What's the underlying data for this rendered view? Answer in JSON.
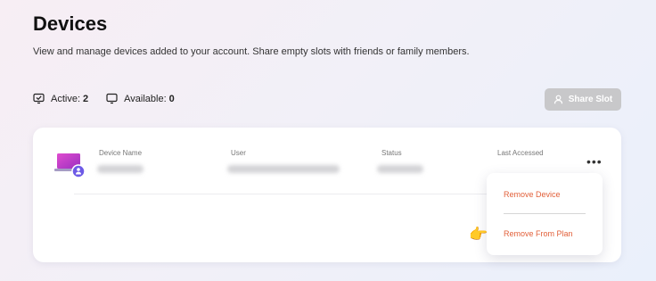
{
  "page": {
    "title": "Devices",
    "subtitle": "View and manage devices added to your account. Share empty slots with friends or family members."
  },
  "stats": {
    "active_label": "Active:",
    "active_value": "2",
    "available_label": "Available:",
    "available_value": "0"
  },
  "share_button": {
    "label": "Share Slot",
    "disabled": true
  },
  "table": {
    "columns": [
      "Device Name",
      "User",
      "Status",
      "Last Accessed"
    ]
  },
  "menu": {
    "items": [
      "Remove Device",
      "Remove From Plan"
    ]
  },
  "colors": {
    "menu_text": "#e2603a",
    "device_icon": "#c23ac9",
    "avatar_badge": "#6d5ae6",
    "button_disabled": "#c8c8ca"
  },
  "icons": [
    "active-device-icon",
    "available-device-icon",
    "user-icon",
    "laptop-icon",
    "more-options-icon",
    "pointing-hand-icon"
  ]
}
